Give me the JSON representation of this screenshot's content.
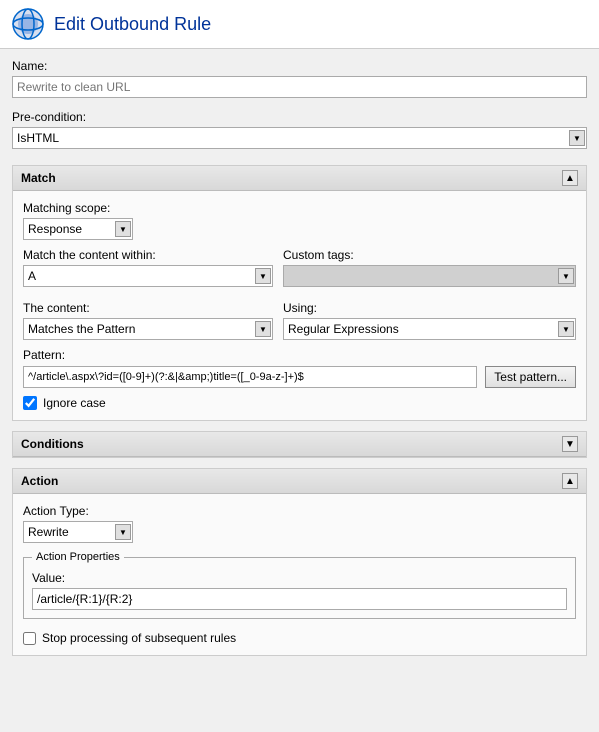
{
  "header": {
    "title": "Edit Outbound Rule",
    "icon_alt": "IIS icon"
  },
  "name_field": {
    "label": "Name:",
    "placeholder": "Rewrite to clean URL",
    "value": ""
  },
  "precondition": {
    "label": "Pre-condition:",
    "options": [
      "IsHTML"
    ],
    "selected": "IsHTML"
  },
  "match_section": {
    "title": "Match",
    "collapsed": false,
    "matching_scope": {
      "label": "Matching scope:",
      "options": [
        "Response"
      ],
      "selected": "Response"
    },
    "content_within": {
      "label": "Match the content within:",
      "options": [
        "A"
      ],
      "selected": "A"
    },
    "custom_tags": {
      "label": "Custom tags:",
      "options": [],
      "selected": ""
    },
    "content": {
      "label": "The content:",
      "options": [
        "Matches the Pattern"
      ],
      "selected": "Matches the Pattern"
    },
    "using": {
      "label": "Using:",
      "options": [
        "Regular Expressions"
      ],
      "selected": "Regular Expressions"
    },
    "pattern": {
      "label": "Pattern:",
      "value": "^/article\\.aspx\\?id=([0-9]+)(?:&|&amp;)title=([_0-9a-z-]+)$"
    },
    "test_pattern_button": "Test pattern...",
    "ignore_case": {
      "label": "Ignore case",
      "checked": true
    }
  },
  "conditions_section": {
    "title": "Conditions",
    "collapsed": true
  },
  "action_section": {
    "title": "Action",
    "collapsed": false,
    "action_type": {
      "label": "Action Type:",
      "options": [
        "Rewrite"
      ],
      "selected": "Rewrite"
    },
    "action_properties_label": "Action Properties",
    "value": {
      "label": "Value:",
      "value": "/article/{R:1}/{R:2}"
    },
    "stop_processing": {
      "label": "Stop processing of subsequent rules",
      "checked": false
    }
  }
}
